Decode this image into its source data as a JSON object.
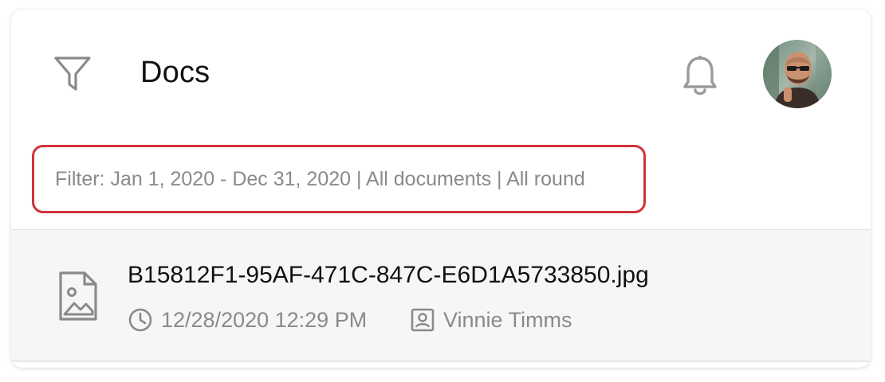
{
  "header": {
    "title": "Docs",
    "filter_icon": "filter-funnel-icon",
    "notification_icon": "bell-icon",
    "avatar": "user-avatar-photo"
  },
  "filter": {
    "text": "Filter: Jan 1, 2020 - Dec 31, 2020 | All documents | All round",
    "highlight_color": "#d0323a"
  },
  "documents": [
    {
      "icon": "image-file-icon",
      "name": "B15812F1-95AF-471C-847C-E6D1A5733850.jpg",
      "timestamp_icon": "clock-icon",
      "timestamp": "12/28/2020 12:29 PM",
      "author_icon": "contact-card-icon",
      "author": "Vinnie Timms"
    }
  ],
  "colors": {
    "row_background": "#f6f6f6",
    "muted_text": "#8a8a8a",
    "primary_text": "#111111"
  }
}
